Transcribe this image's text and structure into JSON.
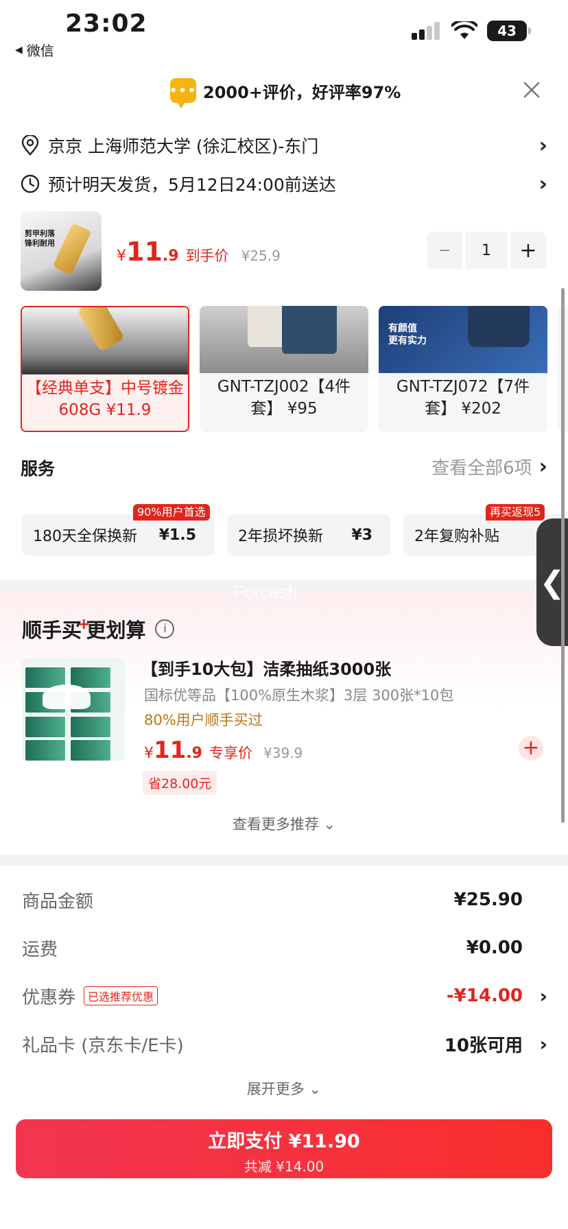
{
  "status_bar": {
    "time": "23:02",
    "back_app": "微信",
    "battery": "43"
  },
  "rating_banner": {
    "chat_icon_glyph": "•••",
    "text": "2000+评价，好评率97%"
  },
  "address": {
    "text": "京京  上海师范大学 (徐汇校区)-东门"
  },
  "delivery": {
    "text": "预计明天发货，5月12日24:00前送达"
  },
  "product": {
    "thumb_text": "剪甲利落\n锋利耐用",
    "price_symbol": "¥",
    "price_int": "11",
    "price_dec": ".9",
    "price_label": "到手价",
    "orig_price": "¥25.9",
    "qty": "1",
    "minus": "−",
    "plus": "+"
  },
  "variants": [
    {
      "name": "【经典单支】中号镀金608G ¥11.9",
      "selected": true
    },
    {
      "name": "GNT-TZJ002【4件套】 ¥95",
      "selected": false
    },
    {
      "name": "GNT-TZJ072【7件套】 ¥202",
      "selected": false,
      "img_text_1": "有颜值",
      "img_text_2": "更有实力"
    }
  ],
  "services": {
    "title": "服务",
    "view_all": "查看全部6项",
    "items": [
      {
        "name": "180天全保换新",
        "price": "¥1.5",
        "badge": "90%用户首选"
      },
      {
        "name": "2年损坏换新",
        "price": "¥3"
      },
      {
        "name": "2年复购补贴",
        "price": "¥",
        "badge": "再买返现5"
      }
    ]
  },
  "side_tab": {
    "glyph": "❮"
  },
  "watermark": "Forcash",
  "recommend": {
    "title_a": "顺手买",
    "title_plus": "+",
    "title_b": "更划算",
    "info_glyph": "i",
    "name": "【到手10大包】洁柔抽纸3000张",
    "spec": "国标优等品【100%原生木浆】3层 300张*10包",
    "bought": "80%用户顺手买过",
    "price_symbol": "¥",
    "price_int": "11",
    "price_dec": ".9",
    "price_label": "专享价",
    "orig_price": "¥39.9",
    "save": "省28.00元",
    "add": "+",
    "more": "查看更多推荐 ⌄"
  },
  "summary": {
    "goods_label": "商品金额",
    "goods_value": "¥25.90",
    "freight_label": "运费",
    "freight_value": "¥0.00",
    "coupon_label": "优惠券",
    "coupon_tag": "已选推荐优惠",
    "coupon_value": "-¥14.00",
    "giftcard_label": "礼品卡 (京东卡/E卡)",
    "giftcard_value": "10张可用",
    "expand": "展开更多 ⌄"
  },
  "pay": {
    "main": "立即支付 ¥11.90",
    "sub": "共减 ¥14.00"
  },
  "colors": {
    "accent": "#e1251b",
    "pay_start": "#f23652",
    "pay_end": "#f72e2b",
    "coupon_orange": "#f6b312"
  }
}
